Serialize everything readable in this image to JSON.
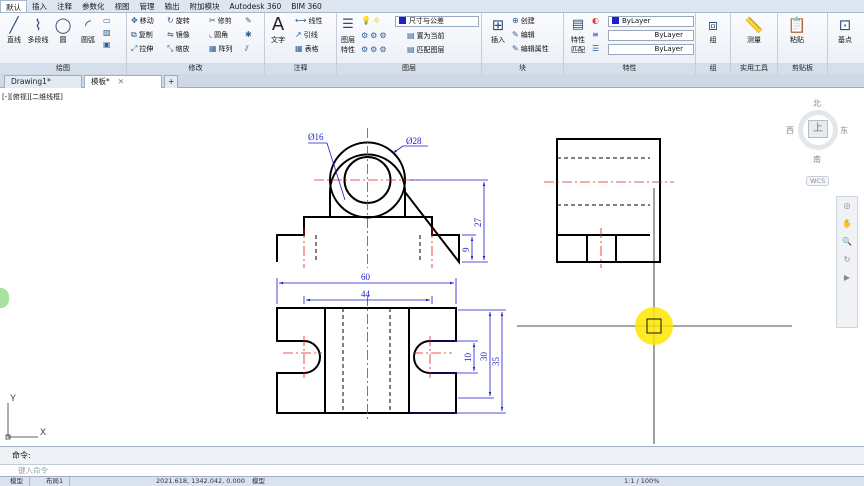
{
  "ribbon_tabs": [
    "默认",
    "插入",
    "注释",
    "参数化",
    "视图",
    "管理",
    "输出",
    "附加模块",
    "Autodesk 360",
    "BIM 360"
  ],
  "ribbon_active_tab": "默认",
  "draw_panel": {
    "title": "绘图",
    "line": "直线",
    "polyline": "多段线",
    "circle": "圆",
    "arc": "圆弧"
  },
  "modify_panel": {
    "title": "修改",
    "rows": [
      [
        "移动",
        "旋转",
        "修剪"
      ],
      [
        "复制",
        "镜像",
        "圆角"
      ],
      [
        "拉伸",
        "缩放",
        "阵列"
      ]
    ]
  },
  "annotation_panel": {
    "title": "注释",
    "text": "文字",
    "items": [
      "线性",
      "引线",
      "表格"
    ]
  },
  "layers_panel": {
    "title": "图层",
    "props": "图层\n特性",
    "props_label": "图层",
    "props_label2": "特性",
    "dropdown": "尺寸与公差",
    "items": [
      "置为当前",
      "匹配图层"
    ]
  },
  "block_panel": {
    "title": "块",
    "insert": "插入",
    "items": [
      "创建",
      "编辑",
      "编辑属性"
    ]
  },
  "properties_panel": {
    "title": "特性",
    "match": "特性",
    "match2": "匹配",
    "color": "ByLayer",
    "linetype": "ByLayer",
    "lineweight": "ByLayer"
  },
  "groups_panel": {
    "title": "组",
    "label": "组"
  },
  "utilities_panel": {
    "title": "实用工具",
    "label": "测量"
  },
  "clipboard_panel": {
    "title": "剪贴板",
    "label": "粘贴"
  },
  "base_panel": {
    "label": "基点"
  },
  "doc_tabs": [
    "Drawing1*",
    "模板*"
  ],
  "doc_tab_add": "+",
  "viewport_label": "[-][俯视][二维线框]",
  "viewcube": {
    "north": "北",
    "south": "南",
    "west": "西",
    "east": "东",
    "face": "上",
    "wcs": "WCS"
  },
  "dimensions": {
    "d16": "Ø16",
    "d28": "Ø28",
    "h27": "27",
    "h9": "9",
    "w60": "60",
    "w44": "44",
    "v10": "10",
    "v30": "30",
    "v35": "35"
  },
  "ucs": {
    "x": "X",
    "y": "Y"
  },
  "command": {
    "history": "命令:",
    "placeholder": "键入命令"
  },
  "status": {
    "model_tab": "模型",
    "layout_tab": "布局1",
    "coords": "2021.618, 1342.042, 0.000",
    "model_label": "模型",
    "scale": "1:1 / 100%"
  },
  "colors": {
    "outline": "#000000",
    "centerline": "#e02020",
    "dimension": "#1a1acc",
    "crosshair_highlight": "#ffe600"
  }
}
